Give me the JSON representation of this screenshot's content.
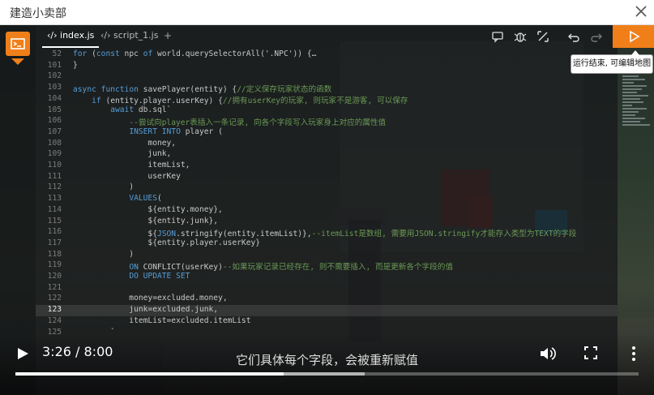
{
  "window": {
    "title": "建造小卖部"
  },
  "editor": {
    "tabs": [
      {
        "label": "index.js",
        "icon": "code-icon",
        "active": true
      },
      {
        "label": "script_1.js",
        "icon": "code-icon",
        "active": false
      }
    ],
    "add_tab": "+",
    "current_line": "123",
    "lines": [
      {
        "n": "52",
        "t": "for (const npc of world.querySelectorAll('.NPC')) {…"
      },
      {
        "n": "101",
        "t": "}"
      },
      {
        "n": "102",
        "t": ""
      },
      {
        "n": "103",
        "t": "async function savePlayer(entity) {//定义保存玩家状态的函数"
      },
      {
        "n": "104",
        "t": "    if (entity.player.userKey) {//拥有userKey的玩家, 则玩家不是游客, 可以保存"
      },
      {
        "n": "105",
        "t": "        await db.sql`"
      },
      {
        "n": "106",
        "t": "            --尝试向player表插入一条记录, 向各个字段写入玩家身上对应的属性值"
      },
      {
        "n": "107",
        "t": "            INSERT INTO player ("
      },
      {
        "n": "108",
        "t": "                money,"
      },
      {
        "n": "109",
        "t": "                junk,"
      },
      {
        "n": "110",
        "t": "                itemList,"
      },
      {
        "n": "111",
        "t": "                userKey"
      },
      {
        "n": "112",
        "t": "            )"
      },
      {
        "n": "113",
        "t": "            VALUES("
      },
      {
        "n": "114",
        "t": "                ${entity.money},"
      },
      {
        "n": "115",
        "t": "                ${entity.junk},"
      },
      {
        "n": "116",
        "t": "                ${JSON.stringify(entity.itemList)},--itemList是数组, 需要用JSON.stringify才能存入类型为TEXT的字段"
      },
      {
        "n": "117",
        "t": "                ${entity.player.userKey}"
      },
      {
        "n": "118",
        "t": "            )"
      },
      {
        "n": "119",
        "t": "            ON CONFLICT(userKey)--如果玩家记录已经存在, 则不需要插入, 而是更新各个字段的值"
      },
      {
        "n": "120",
        "t": "            DO UPDATE SET"
      },
      {
        "n": "121",
        "t": ""
      },
      {
        "n": "122",
        "t": "            money=excluded.money,"
      },
      {
        "n": "123",
        "t": "            junk=excluded.junk,"
      },
      {
        "n": "124",
        "t": "            itemList=excluded.itemList"
      },
      {
        "n": "125",
        "t": "        `"
      }
    ]
  },
  "toolbar": {
    "icons": [
      "comment-icon",
      "bug-icon",
      "expand-icon",
      "undo-icon",
      "redo-icon"
    ],
    "run_icon": "play-outline-icon",
    "tooltip": "运行结束, 可编辑地图"
  },
  "player": {
    "time": "3:26 / 8:00",
    "subtitle": "它们具体每个字段，会被重新赋值",
    "progress": 0.43,
    "buffered": 0.56
  },
  "colors": {
    "accent": "#f07f1a",
    "keyword": "#569cd6",
    "comment": "#6a9955"
  }
}
